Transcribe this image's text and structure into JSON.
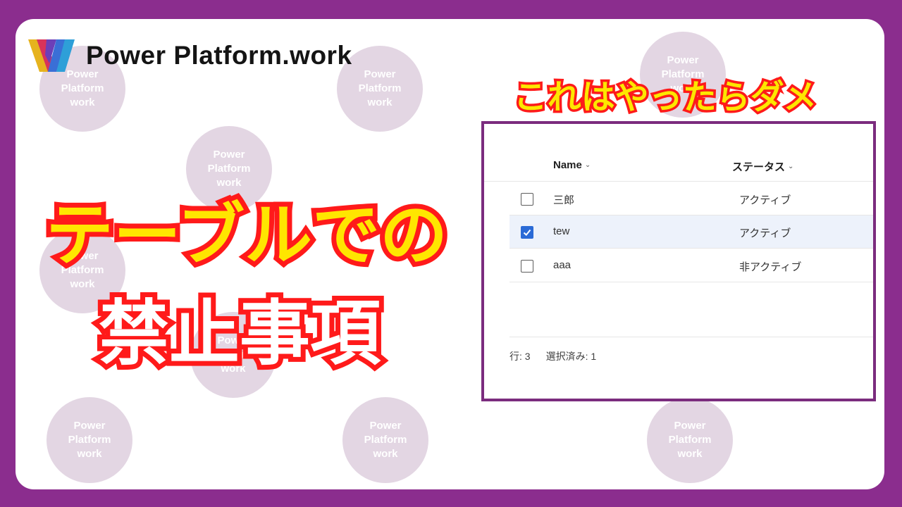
{
  "brand": {
    "name": "Power Platform.work",
    "watermark_lines": [
      "Power",
      "Platform",
      "work"
    ]
  },
  "badge": {
    "text": "これはやったらダメ"
  },
  "headline": {
    "line1": "テーブルでの",
    "line2": "禁止事項"
  },
  "table": {
    "columns": [
      {
        "label": "Name"
      },
      {
        "label": "ステータス"
      }
    ],
    "rows": [
      {
        "name": "三郎",
        "status": "アクティブ",
        "checked": false
      },
      {
        "name": "tew",
        "status": "アクティブ",
        "checked": true
      },
      {
        "name": "aaa",
        "status": "非アクティブ",
        "checked": false
      }
    ],
    "footer": {
      "row_count": "行: 3",
      "selected_count": "選択済み: 1"
    }
  },
  "colors": {
    "frame": "#8b2d8e",
    "accent_yellow": "#ffe600",
    "accent_red": "#ff1a1a",
    "checkbox_blue": "#2a6ad6",
    "selected_row": "#edf2fb"
  }
}
